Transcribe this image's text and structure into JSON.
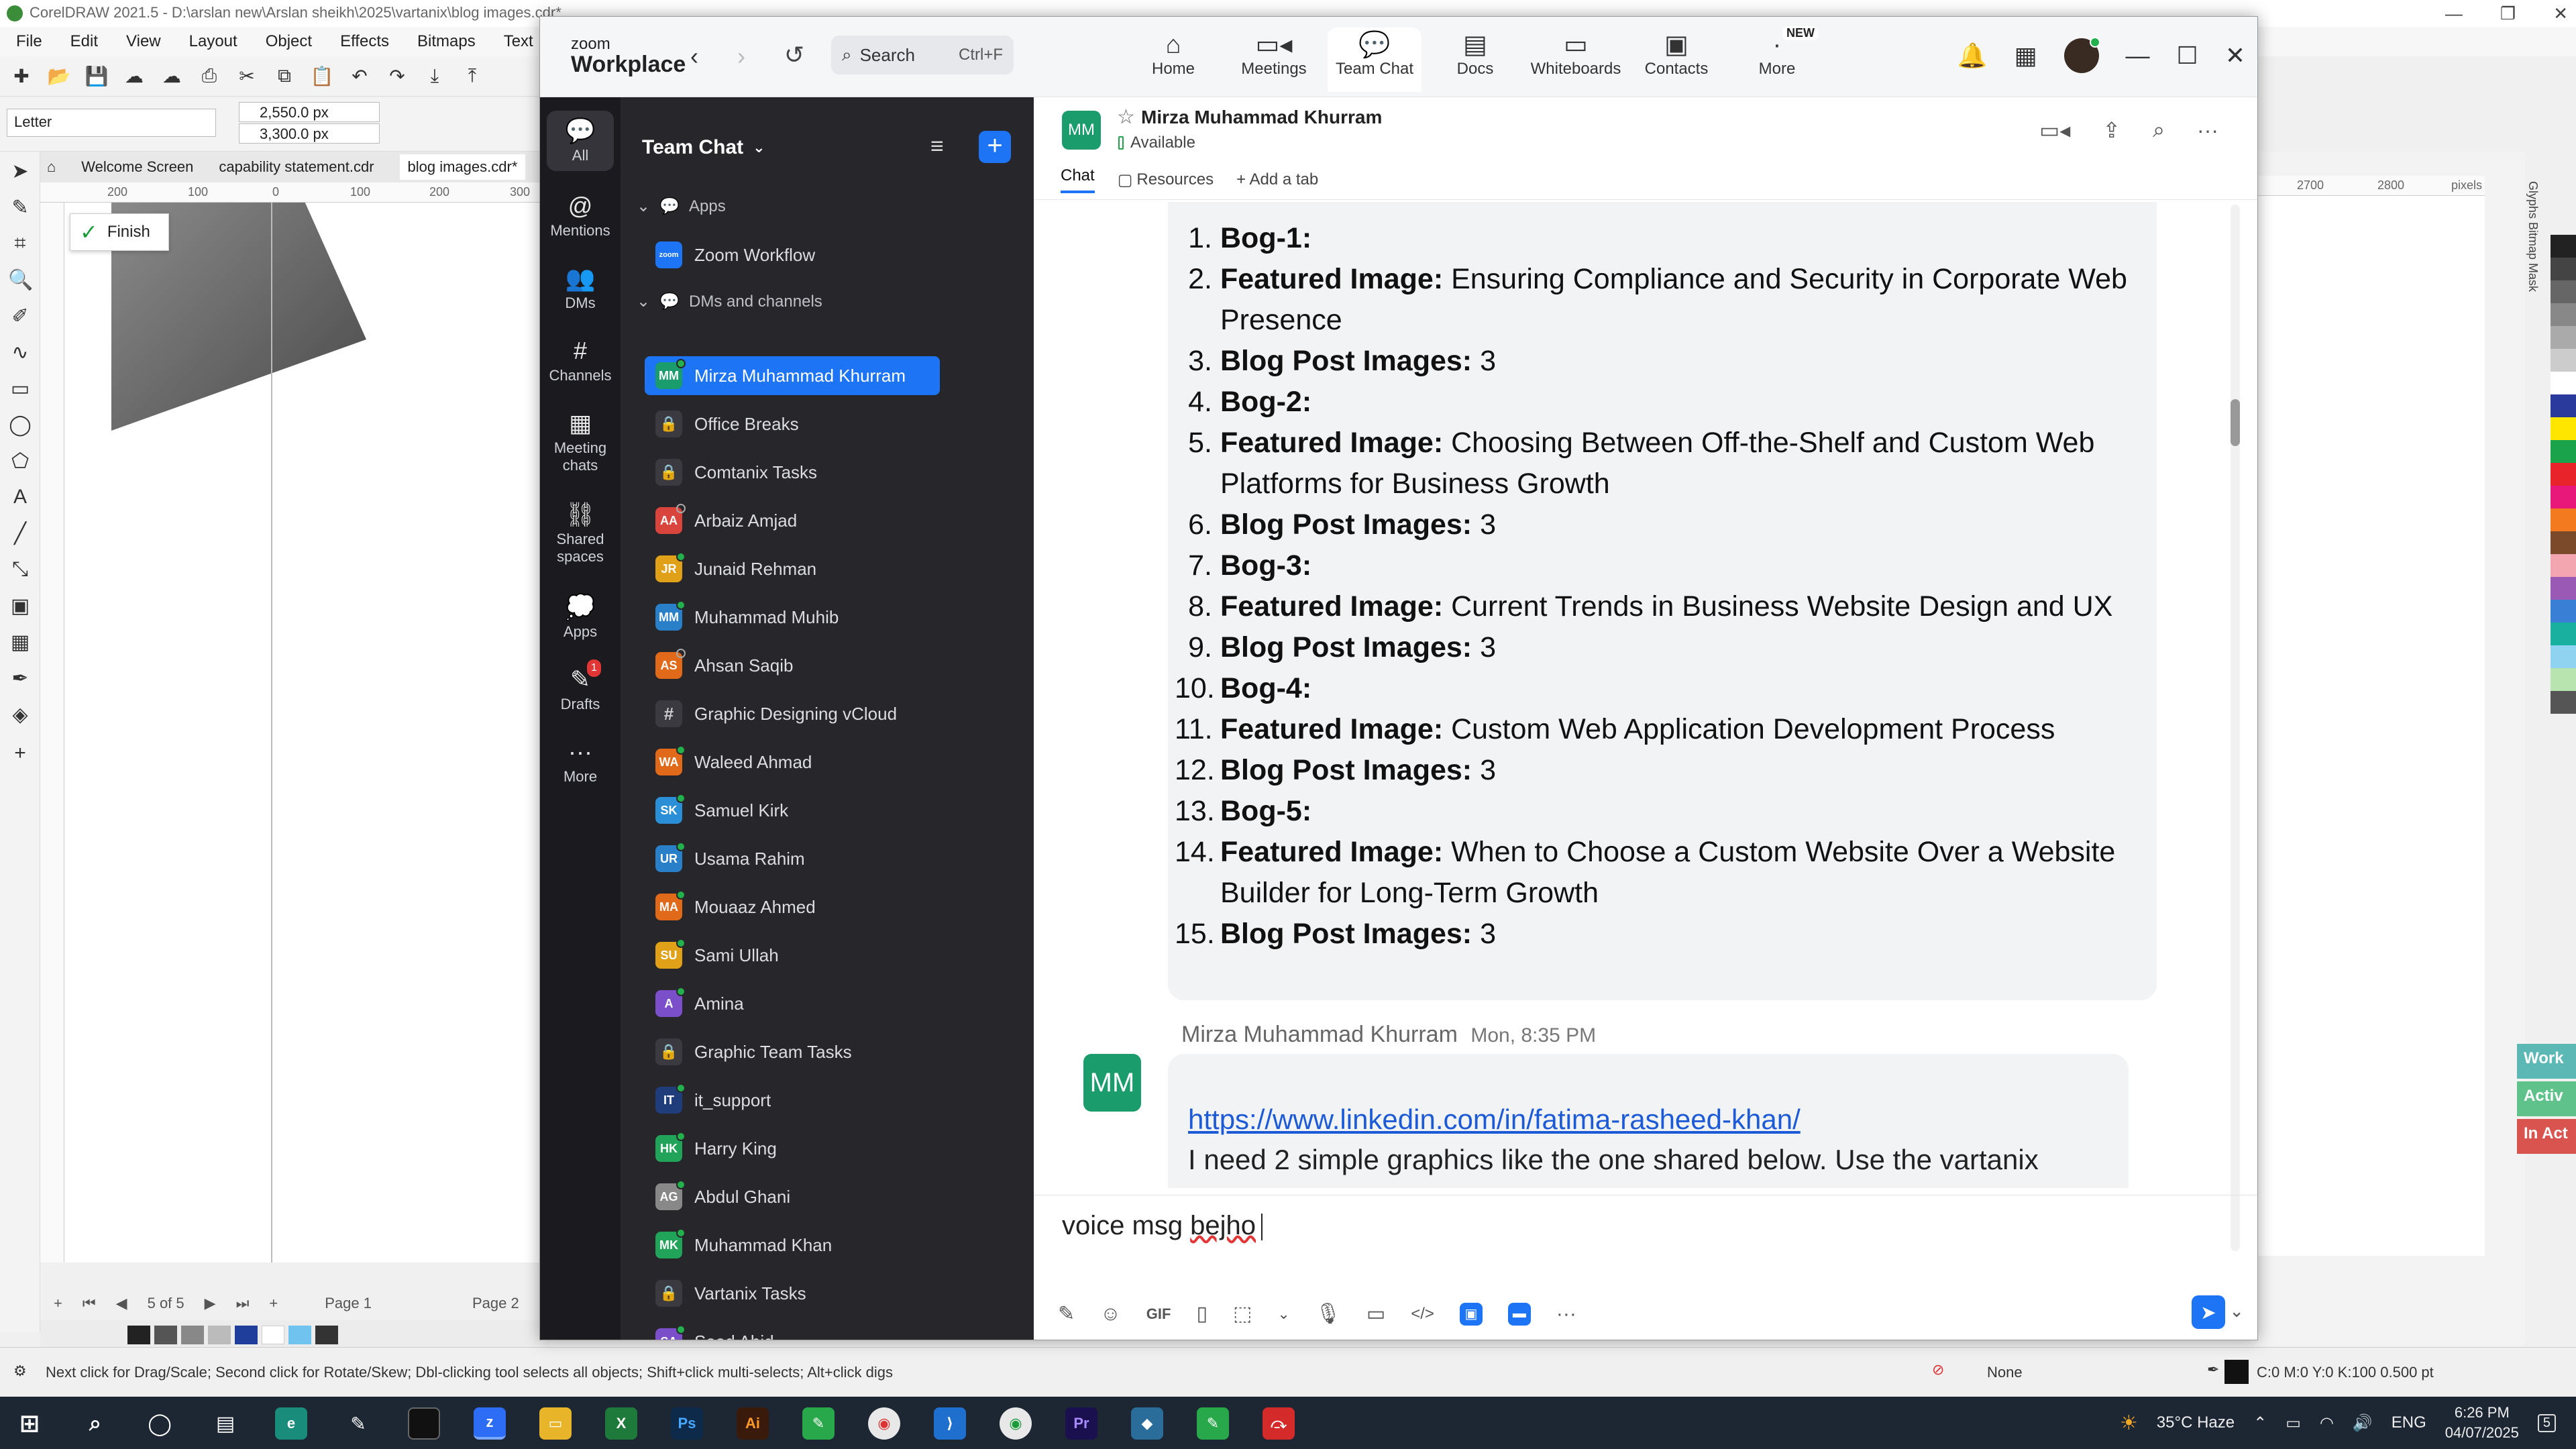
{
  "coreldraw": {
    "title": "CorelDRAW 2021.5 - D:\\arslan new\\Arslan sheikh\\2025\\vartanix\\blog images.cdr*",
    "menu": [
      "File",
      "Edit",
      "View",
      "Layout",
      "Object",
      "Effects",
      "Bitmaps",
      "Text"
    ],
    "paper_size": "Letter",
    "width": "2,550.0 px",
    "height": "3,300.0 px",
    "doc_tabs": [
      "Welcome Screen",
      "capability statement.cdr",
      "blog images.cdr*"
    ],
    "ruler_ticks": [
      "200",
      "100",
      "0",
      "100",
      "200",
      "300"
    ],
    "ruler_ticks_right": [
      "2700",
      "2800",
      "pixels"
    ],
    "finish_label": "Finish",
    "page_counter": "5 of 5",
    "pages": [
      "Page 1",
      "Page 2"
    ],
    "status_hint": "Next click for Drag/Scale; Second click for Rotate/Skew; Dbl-clicking tool selects all objects; Shift+click multi-selects; Alt+click digs",
    "fill_none": "None",
    "outline_info": "C:0 M:0 Y:0 K:100  0.500 pt",
    "dockers": "Glyphs  Bitmap Mask",
    "hint_buttons": [
      "Work",
      "Activ",
      "In Act"
    ],
    "hint_colors": [
      "#5bb8b5",
      "#5fc28a",
      "#d9534f"
    ]
  },
  "taskbar": {
    "weather": "35°C Haze",
    "lang": "ENG",
    "time": "6:26 PM",
    "date": "04/07/2025",
    "notif_count": "5",
    "apps": [
      "Ps",
      "Ai",
      "Pr"
    ]
  },
  "zoom": {
    "logo_top": "zoom",
    "logo_bottom": "Workplace",
    "search_placeholder": "Search",
    "search_shortcut": "Ctrl+F",
    "nav": [
      {
        "label": "Home",
        "icon": "home-icon"
      },
      {
        "label": "Meetings",
        "icon": "video-icon"
      },
      {
        "label": "Team Chat",
        "icon": "chat-icon"
      },
      {
        "label": "Docs",
        "icon": "docs-icon"
      },
      {
        "label": "Whiteboards",
        "icon": "whiteboard-icon"
      },
      {
        "label": "Contacts",
        "icon": "contacts-icon"
      },
      {
        "label": "More",
        "icon": "more-icon"
      }
    ],
    "new_badge": "NEW",
    "rail": [
      {
        "label": "All",
        "icon": "chat-icon"
      },
      {
        "label": "Mentions",
        "icon": "at-icon"
      },
      {
        "label": "DMs",
        "icon": "people-icon"
      },
      {
        "label": "Channels",
        "icon": "hash-icon"
      },
      {
        "label": "Meeting chats",
        "icon": "calendar-icon"
      },
      {
        "label": "Shared spaces",
        "icon": "shared-icon"
      },
      {
        "label": "Apps",
        "icon": "apps-icon"
      },
      {
        "label": "Drafts",
        "icon": "drafts-icon"
      },
      {
        "label": "More",
        "icon": "ellipsis-icon"
      }
    ],
    "drafts_badge": "1",
    "sidebar": {
      "title": "Team Chat",
      "section_apps": "Apps",
      "app_item": "Zoom Workflow",
      "app_icon_text": "zoom",
      "section_dms": "DMs and channels",
      "items": [
        {
          "name": "Mirza Muhammad Khurram",
          "initials": "MM",
          "color": "#1a9c6c",
          "kind": "person",
          "status": "online",
          "selected": true
        },
        {
          "name": "Office Breaks",
          "kind": "lock"
        },
        {
          "name": "Comtanix Tasks",
          "kind": "lock"
        },
        {
          "name": "Arbaiz Amjad",
          "initials": "AA",
          "color": "#d9453d",
          "kind": "person",
          "status": "off"
        },
        {
          "name": "Junaid Rehman",
          "initials": "JR",
          "color": "#e0a018",
          "kind": "person",
          "status": "online"
        },
        {
          "name": "Muhammad Muhib",
          "initials": "MM",
          "color": "#2a7fc9",
          "kind": "person",
          "status": "online"
        },
        {
          "name": "Ahsan Saqib",
          "initials": "AS",
          "color": "#e06a1a",
          "kind": "person",
          "status": "off"
        },
        {
          "name": "Graphic Designing vCloud",
          "kind": "hash"
        },
        {
          "name": "Waleed Ahmad",
          "initials": "WA",
          "color": "#e06a1a",
          "kind": "person",
          "status": "online"
        },
        {
          "name": "Samuel Kirk",
          "initials": "SK",
          "color": "#2a8fd6",
          "kind": "person",
          "status": "online"
        },
        {
          "name": "Usama Rahim",
          "initials": "UR",
          "color": "#2a7fc9",
          "kind": "person",
          "status": "online"
        },
        {
          "name": "Mouaaz Ahmed",
          "initials": "MA",
          "color": "#e06a1a",
          "kind": "person",
          "status": "online"
        },
        {
          "name": "Sami Ullah",
          "initials": "SU",
          "color": "#e0a018",
          "kind": "person",
          "status": "online"
        },
        {
          "name": "Amina",
          "initials": "A",
          "color": "#7b4fc9",
          "kind": "person",
          "status": "online"
        },
        {
          "name": "Graphic Team Tasks",
          "kind": "lock"
        },
        {
          "name": "it_support",
          "initials": "IT",
          "color": "#1f3d7a",
          "kind": "person",
          "status": "online"
        },
        {
          "name": "Harry King",
          "initials": "HK",
          "color": "#22a35a",
          "kind": "person",
          "status": "online"
        },
        {
          "name": "Abdul Ghani",
          "initials": "AG",
          "color": "#888888",
          "kind": "person",
          "status": "online"
        },
        {
          "name": "Muhammad Khan",
          "initials": "MK",
          "color": "#22a35a",
          "kind": "person",
          "status": "online"
        },
        {
          "name": "Vartanix Tasks",
          "kind": "lock"
        },
        {
          "name": "Saad Abid",
          "initials": "SA",
          "color": "#7b4fc9",
          "kind": "person",
          "status": "online"
        }
      ]
    },
    "chat": {
      "contact_name": "Mirza Muhammad Khurram",
      "contact_initials": "MM",
      "status": "Available",
      "tabs": [
        "Chat",
        "Resources",
        "+ Add a tab"
      ],
      "list": [
        {
          "n": "1.",
          "bold": "Bog-1:",
          "rest": ""
        },
        {
          "n": "2.",
          "bold": "Featured Image:",
          "rest": " Ensuring Compliance and Security in Corporate Web Presence"
        },
        {
          "n": "3.",
          "bold": "Blog Post Images:",
          "rest": " 3"
        },
        {
          "n": "4.",
          "bold": "Bog-2:",
          "rest": ""
        },
        {
          "n": "5.",
          "bold": "Featured Image:",
          "rest": " Choosing Between Off-the-Shelf and Custom Web Platforms for Business Growth"
        },
        {
          "n": "6.",
          "bold": "Blog Post Images:",
          "rest": " 3"
        },
        {
          "n": "7.",
          "bold": "Bog-3:",
          "rest": ""
        },
        {
          "n": "8.",
          "bold": "Featured Image:",
          "rest": " Current Trends in Business Website Design and UX"
        },
        {
          "n": "9.",
          "bold": "Blog Post Images:",
          "rest": " 3"
        },
        {
          "n": "10.",
          "bold": "Bog-4:",
          "rest": ""
        },
        {
          "n": "11.",
          "bold": "Featured Image:",
          "rest": " Custom Web Application Development Process"
        },
        {
          "n": "12.",
          "bold": "Blog Post Images:",
          "rest": " 3"
        },
        {
          "n": "13.",
          "bold": "Bog-5:",
          "rest": ""
        },
        {
          "n": "14.",
          "bold": "Featured Image:",
          "rest": " When to Choose a Custom Website Over a Website Builder for Long-Term Growth"
        },
        {
          "n": "15.",
          "bold": "Blog Post Images:",
          "rest": " 3"
        }
      ],
      "msg2_sender": "Mirza Muhammad Khurram",
      "msg2_time": "Mon, 8:35 PM",
      "msg2_link": "https://www.linkedin.com/in/fatima-rasheed-khan/",
      "msg2_text": "I need 2 simple graphics like the one shared below. Use the vartanix",
      "compose_before": "voice msg ",
      "compose_spell": "bejho",
      "compose_tools": [
        "format-icon",
        "emoji-icon",
        "GIF",
        "file-icon",
        "screenshot-icon",
        "chevron-down-icon",
        "mic-icon",
        "video-clip-icon",
        "code-icon",
        "app1-icon",
        "app2-icon",
        "more-icon"
      ]
    }
  }
}
